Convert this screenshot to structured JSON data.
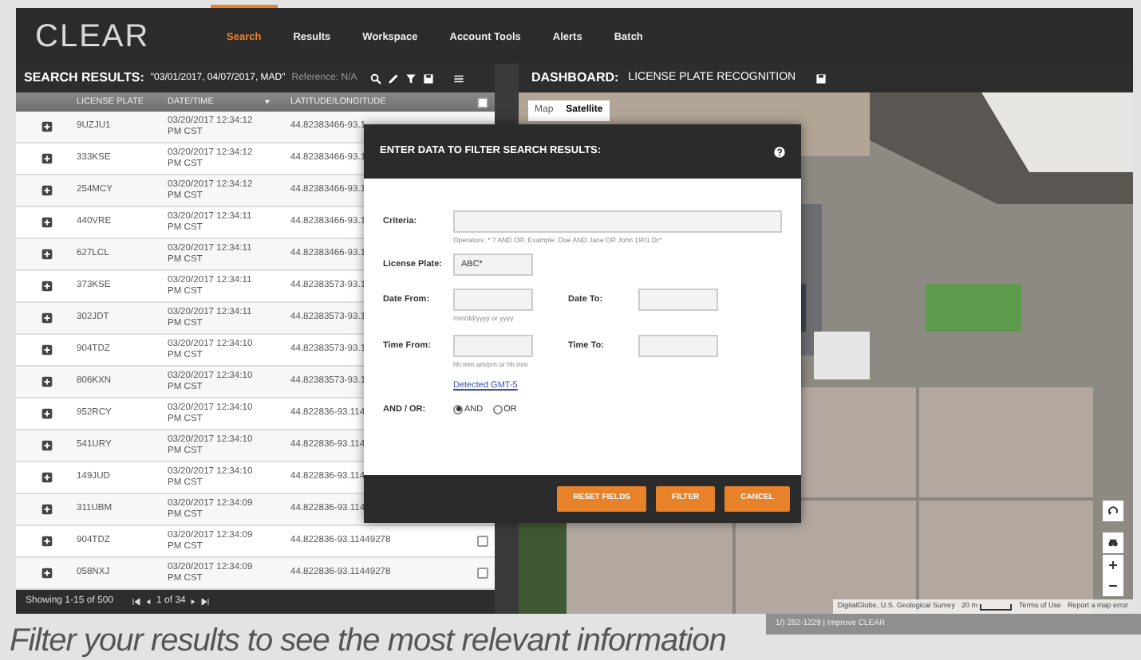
{
  "nav": {
    "logo": "CLEAR",
    "items": [
      {
        "label": "Search",
        "selected": true
      },
      {
        "label": "Results",
        "selected": false
      },
      {
        "label": "Workspace",
        "selected": false
      },
      {
        "label": "Account Tools",
        "selected": false
      },
      {
        "label": "Alerts",
        "selected": false
      },
      {
        "label": "Batch",
        "selected": false
      }
    ]
  },
  "results_panel": {
    "title": "SEARCH RESULTS:",
    "query": "\"03/01/2017, 04/07/2017, MAD\"",
    "reference": "Reference: N/A",
    "columns": [
      {
        "label": "LICENSE PLATE",
        "sorted": false
      },
      {
        "label": "DATE/TIME",
        "sorted": true
      },
      {
        "label": "LATITUDE/LONGITUDE",
        "sorted": false
      }
    ],
    "select_all": {
      "checked": false
    },
    "rows": [
      {
        "plate": "9UZJU1",
        "datetime": "03/20/2017 12:34:12 PM CST",
        "location": "44.82383466-93.1"
      },
      {
        "plate": "333KSE",
        "datetime": "03/20/2017 12:34:12 PM CST",
        "location": "44.82383466-93.1"
      },
      {
        "plate": "254MCY",
        "datetime": "03/20/2017 12:34:12 PM CST",
        "location": "44.82383466-93.1"
      },
      {
        "plate": "440VRE",
        "datetime": "03/20/2017 12:34:11 PM CST",
        "location": "44.82383466-93.1"
      },
      {
        "plate": "627LCL",
        "datetime": "03/20/2017 12:34:11 PM CST",
        "location": "44.82383466-93.1"
      },
      {
        "plate": "373KSE",
        "datetime": "03/20/2017 12:34:11 PM CST",
        "location": "44.82383573-93.1"
      },
      {
        "plate": "302JDT",
        "datetime": "03/20/2017 12:34:11 PM CST",
        "location": "44.82383573-93.1"
      },
      {
        "plate": "904TDZ",
        "datetime": "03/20/2017 12:34:10 PM CST",
        "location": "44.82383573-93.1"
      },
      {
        "plate": "806KXN",
        "datetime": "03/20/2017 12:34:10 PM CST",
        "location": "44.82383573-93.1"
      },
      {
        "plate": "952RCY",
        "datetime": "03/20/2017 12:34:10 PM CST",
        "location": "44.822836-93.114"
      },
      {
        "plate": "541URY",
        "datetime": "03/20/2017 12:34:10 PM CST",
        "location": "44.822836-93.114"
      },
      {
        "plate": "149JUD",
        "datetime": "03/20/2017 12:34:10 PM CST",
        "location": "44.822836-93.114"
      },
      {
        "plate": "311UBM",
        "datetime": "03/20/2017 12:34:09 PM CST",
        "location": "44.822836-93.114"
      },
      {
        "plate": "904TDZ",
        "datetime": "03/20/2017 12:34:09 PM CST",
        "location": "44.822836-93.11449278",
        "checked": false
      },
      {
        "plate": "058NXJ",
        "datetime": "03/20/2017 12:34:09 PM CST",
        "location": "44.822836-93.11449278",
        "checked": false
      }
    ],
    "footer": {
      "showing": "Showing 1-15 of 500",
      "page": "1 of 34"
    }
  },
  "dashboard": {
    "title": "DASHBOARD:",
    "subtitle": "LICENSE PLATE RECOGNITION",
    "map": {
      "kind": "picture",
      "map_types": [
        {
          "label": "Map",
          "selected": false
        },
        {
          "label": "Satellite",
          "selected": true
        }
      ],
      "attribution": "DigitalGlobe, U.S. Geological Survey",
      "scale": "20 m",
      "terms": "Terms of Use",
      "report": "Report a map error"
    },
    "support": "1/) 282-1229 | Improve CLEAR"
  },
  "modal": {
    "title": "ENTER DATA TO FILTER SEARCH RESULTS:",
    "criteria": {
      "label": "Criteria:",
      "hint": "Operators: * ? AND OR. Example: Doe AND Jane OR John 1901 Dr*"
    },
    "license_plate": {
      "label": "License Plate:",
      "value": "ABC*"
    },
    "date_from": {
      "label": "Date From:",
      "hint": "mm/dd/yyyy or yyyy"
    },
    "date_to": {
      "label": "Date To:"
    },
    "time_from": {
      "label": "Time From:",
      "hint": "hh:mm am/pm or hh:mm"
    },
    "time_to": {
      "label": "Time To:"
    },
    "timezone": "Detected GMT-5",
    "logic": {
      "label": "AND / OR:",
      "options": [
        {
          "label": "AND",
          "selected": true
        },
        {
          "label": "OR",
          "selected": false
        }
      ]
    },
    "buttons": [
      "RESET FIELDS",
      "FILTER",
      "CANCEL"
    ]
  },
  "caption": "Filter your results to see the most relevant information"
}
